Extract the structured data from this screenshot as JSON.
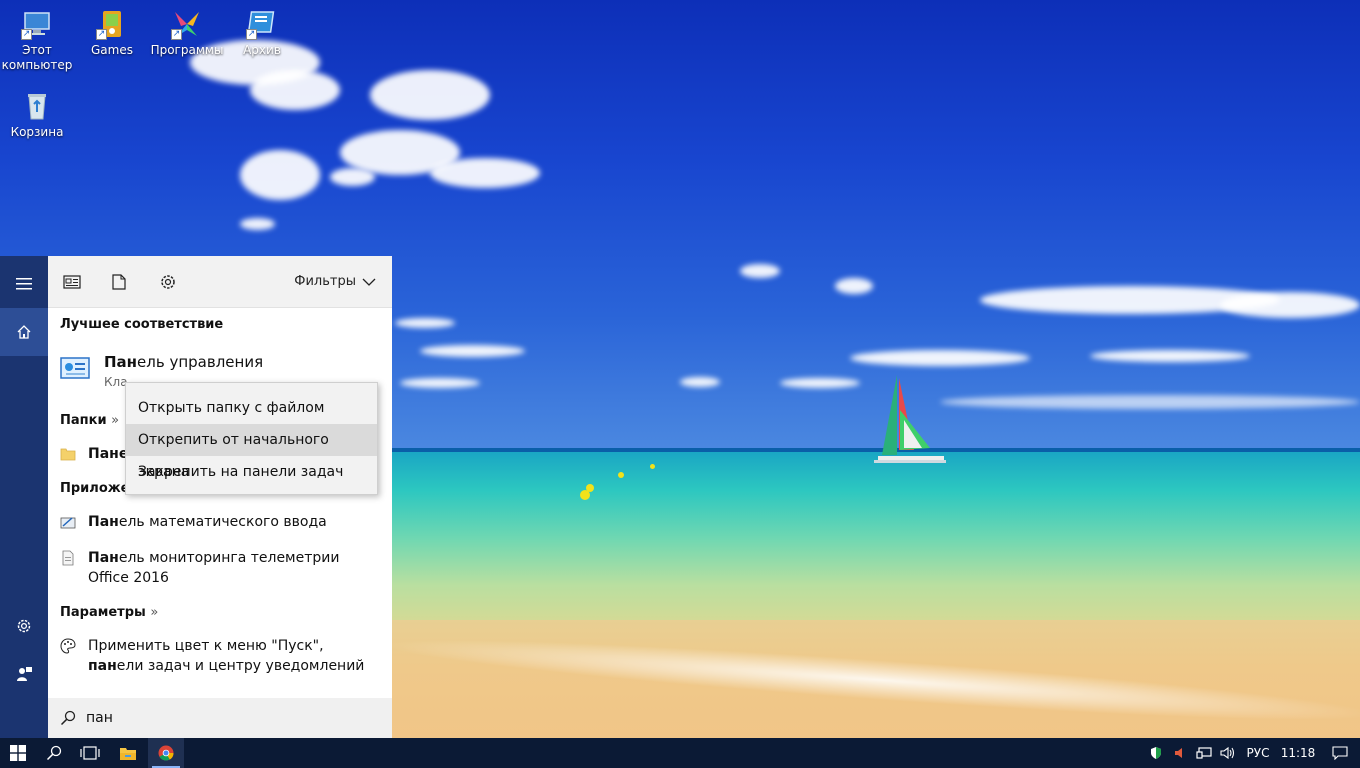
{
  "desktop": {
    "icons": [
      {
        "label": "Этот компьютер",
        "icon": "computer-icon"
      },
      {
        "label": "Games",
        "icon": "games-folder-icon"
      },
      {
        "label": "Программы",
        "icon": "programs-icon"
      },
      {
        "label": "Архив",
        "icon": "archive-icon"
      },
      {
        "label": "Корзина",
        "icon": "recycle-bin-icon"
      }
    ]
  },
  "start_rail": {
    "items": [
      "hamburger-menu-icon",
      "home-icon",
      "settings-icon",
      "feedback-icon"
    ]
  },
  "search_panel": {
    "tabs": [
      "apps-tab-icon",
      "documents-tab-icon",
      "settings-tab-icon"
    ],
    "filters_label": "Фильтры",
    "best_match_header": "Лучшее соответствие",
    "best_match": {
      "title_bold": "Пан",
      "title_rest": "ель управления",
      "subtitle": "Кла"
    },
    "folders_header": "Папки",
    "folders": [
      {
        "bold": "Пане",
        "rest": ""
      }
    ],
    "apps_header": "Приложен",
    "apps": [
      {
        "bold": "Пан",
        "rest": "ель математического ввода"
      },
      {
        "bold": "Пан",
        "rest": "ель мониторинга телеметрии Office 2016"
      }
    ],
    "settings_header": "Параметры",
    "settings": [
      {
        "pre": "Применить цвет к меню \"Пуск\", ",
        "bold": "пан",
        "rest": "ели задач и центру уведомлений"
      }
    ],
    "search_value": "пан",
    "header_arrow": "»"
  },
  "context_menu": {
    "items": [
      {
        "label": "Открыть папку с файлом"
      },
      {
        "label": "Открепить от начального экрана"
      },
      {
        "label": "Закрепить на панели задач"
      }
    ],
    "hovered_index": 1
  },
  "taskbar": {
    "buttons": [
      "windows-start-icon",
      "search-icon",
      "task-view-icon",
      "file-explorer-icon",
      "chrome-icon"
    ],
    "tray": {
      "language": "РУС",
      "time": "11:18"
    }
  },
  "colors": {
    "rail": "#1b3470",
    "taskbar": "#0b1a35",
    "accent": "#2d4e96"
  }
}
